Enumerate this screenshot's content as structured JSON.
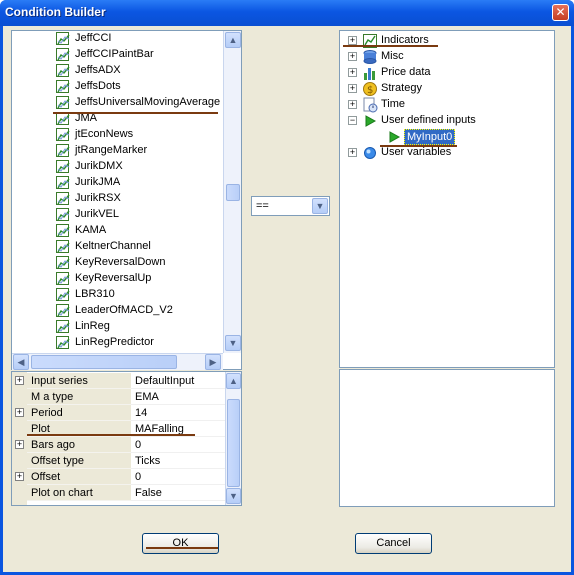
{
  "window": {
    "title": "Condition Builder",
    "close_glyph": "✕"
  },
  "indicator_list": {
    "items": [
      "JeffCCI",
      "JeffCCIPaintBar",
      "JeffsADX",
      "JeffsDots",
      "JeffsUniversalMovingAverage",
      "JMA",
      "jtEconNews",
      "jtRangeMarker",
      "JurikDMX",
      "JurikJMA",
      "JurikRSX",
      "JurikVEL",
      "KAMA",
      "KeltnerChannel",
      "KeyReversalDown",
      "KeyReversalUp",
      "LBR310",
      "LeaderOfMACD_V2",
      "LinReg",
      "LinRegPredictor"
    ],
    "selected": "JeffsUniversalMovingAverage",
    "scroll_up_glyph": "▲",
    "scroll_down_glyph": "▼",
    "scroll_left_glyph": "◀",
    "scroll_right_glyph": "▶"
  },
  "properties": {
    "rows": [
      {
        "expandable": true,
        "name": "Input series",
        "value": "DefaultInput"
      },
      {
        "expandable": false,
        "name": "M a type",
        "value": "EMA"
      },
      {
        "expandable": true,
        "name": "Period",
        "value": "14"
      },
      {
        "expandable": false,
        "name": "Plot",
        "value": "MAFalling"
      },
      {
        "expandable": true,
        "name": "Bars ago",
        "value": "0"
      },
      {
        "expandable": false,
        "name": "Offset type",
        "value": "Ticks"
      },
      {
        "expandable": true,
        "name": "Offset",
        "value": "0"
      },
      {
        "expandable": false,
        "name": "Plot on chart",
        "value": "False"
      }
    ],
    "expand_glyph": "+"
  },
  "operator": {
    "value": "==",
    "drop_glyph": "▼"
  },
  "tree": {
    "nodes": [
      {
        "label": "Indicators",
        "toggle": "+",
        "icon": "indicator-chart-icon",
        "level": 0
      },
      {
        "label": "Misc",
        "toggle": "+",
        "icon": "database-icon",
        "level": 0
      },
      {
        "label": "Price data",
        "toggle": "+",
        "icon": "bar-chart-icon",
        "level": 0
      },
      {
        "label": "Strategy",
        "toggle": "+",
        "icon": "coin-icon",
        "level": 0
      },
      {
        "label": "Time",
        "toggle": "+",
        "icon": "clock-document-icon",
        "level": 0
      },
      {
        "label": "User defined inputs",
        "toggle": "−",
        "icon": "play-arrow-icon",
        "level": 0
      },
      {
        "label": "MyInput0",
        "toggle": "",
        "icon": "play-arrow-icon",
        "level": 1,
        "selected": true
      },
      {
        "label": "User variables",
        "toggle": "+",
        "icon": "blue-orb-icon",
        "level": 0
      }
    ]
  },
  "buttons": {
    "ok": "OK",
    "cancel": "Cancel"
  },
  "colors": {
    "title_bar": "#0b56e2",
    "selection": "#316ac5",
    "annotation_underline": "#7a3a10",
    "dialog_bg": "#ece9d8"
  }
}
